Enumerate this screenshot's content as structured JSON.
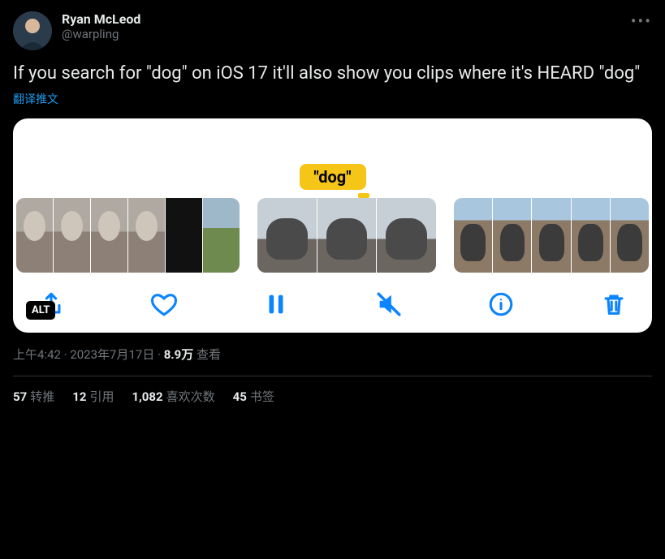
{
  "author": {
    "display_name": "Ryan McLeod",
    "handle": "@warpling"
  },
  "body_text": "If you search for \"dog\" on iOS 17 it'll also show you clips where it's HEARD \"dog\"",
  "translate_label": "翻译推文",
  "media": {
    "caption_badge": "\"dog\"",
    "alt_badge": "ALT"
  },
  "meta": {
    "time": "上午4:42",
    "date": "2023年7月17日",
    "views_count": "8.9万",
    "views_label": "查看"
  },
  "stats": {
    "retweets_count": "57",
    "retweets_label": "转推",
    "quotes_count": "12",
    "quotes_label": "引用",
    "likes_count": "1,082",
    "likes_label": "喜欢次数",
    "bookmarks_count": "45",
    "bookmarks_label": "书签"
  }
}
